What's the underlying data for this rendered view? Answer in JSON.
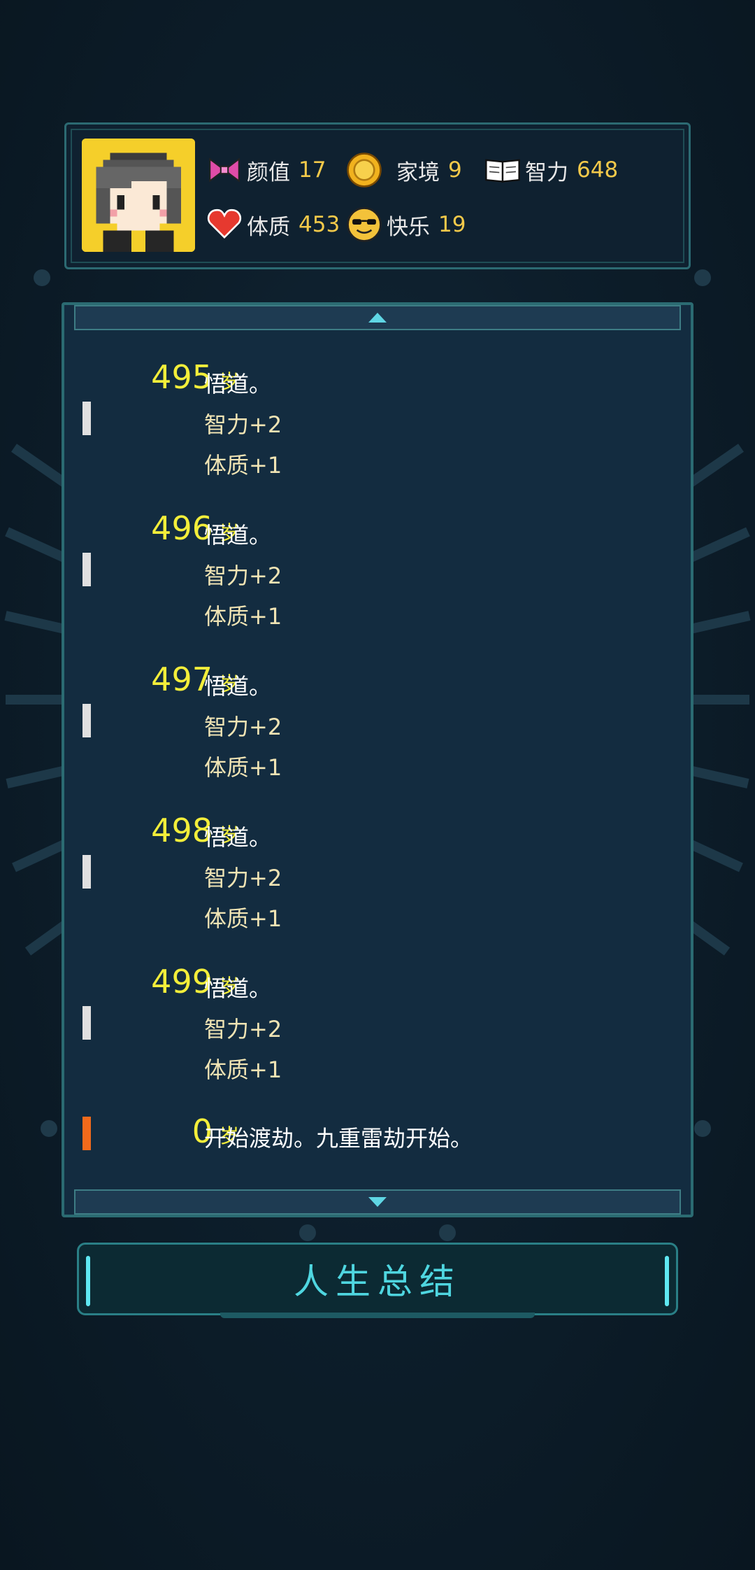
{
  "stats": [
    {
      "icon": "bow-icon",
      "label": "颜值",
      "value": "17"
    },
    {
      "icon": "coin-icon",
      "label": "家境",
      "value": "9"
    },
    {
      "icon": "book-icon",
      "label": "智力",
      "value": "648"
    },
    {
      "icon": "heart-icon",
      "label": "体质",
      "value": "453"
    },
    {
      "icon": "sunglasses-face-icon",
      "label": "快乐",
      "value": "19"
    }
  ],
  "age_unit": "岁",
  "log": [
    {
      "age": "495",
      "lines": [
        "悟道。",
        "智力+2",
        "体质+1"
      ],
      "marker": "white"
    },
    {
      "age": "496",
      "lines": [
        "悟道。",
        "智力+2",
        "体质+1"
      ],
      "marker": "white"
    },
    {
      "age": "497",
      "lines": [
        "悟道。",
        "智力+2",
        "体质+1"
      ],
      "marker": "white"
    },
    {
      "age": "498",
      "lines": [
        "悟道。",
        "智力+2",
        "体质+1"
      ],
      "marker": "white"
    },
    {
      "age": "499",
      "lines": [
        "悟道。",
        "智力+2",
        "体质+1"
      ],
      "marker": "white"
    },
    {
      "age": "0",
      "lines": [
        "开始渡劫。九重雷劫开始。"
      ],
      "marker": "orange"
    }
  ],
  "summary_button": "人生总结",
  "colors": {
    "age": "#f3ee3a",
    "stat_value": "#f3c94a",
    "accent": "#4fd6e0",
    "marker_orange": "#f26a1b"
  }
}
